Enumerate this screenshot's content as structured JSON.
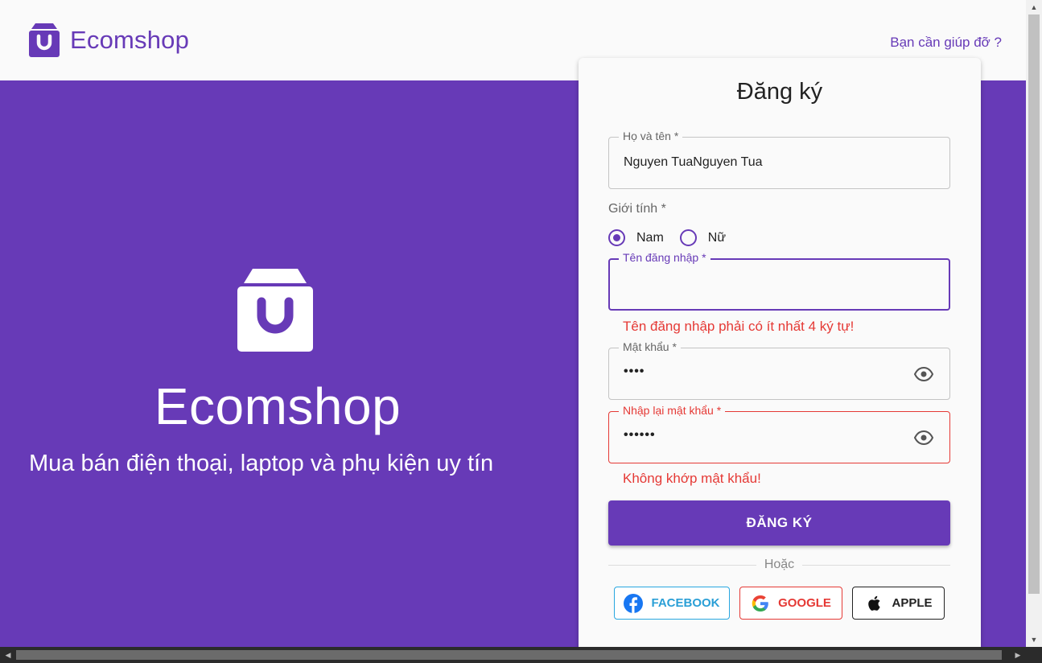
{
  "header": {
    "brand": "Ecomshop",
    "help_link": "Bạn cần giúp đỡ ?"
  },
  "hero": {
    "title": "Ecomshop",
    "subtitle": "Mua bán điện thoại, laptop và phụ kiện uy tín"
  },
  "form": {
    "title": "Đăng ký",
    "fullname": {
      "label": "Họ và tên *",
      "value": "Nguyen TuaNguyen Tua"
    },
    "gender": {
      "label": "Giới tính *",
      "options": [
        {
          "label": "Nam",
          "checked": true
        },
        {
          "label": "Nữ",
          "checked": false
        }
      ]
    },
    "username": {
      "label": "Tên đăng nhập *",
      "value": "",
      "error": "Tên đăng nhập phải có ít nhất 4 ký tự!"
    },
    "password": {
      "label": "Mật khẩu *",
      "value": "••••"
    },
    "confirm_password": {
      "label": "Nhập lại mật khẩu *",
      "value": "••••••",
      "error": "Không khớp mật khẩu!"
    },
    "submit_label": "ĐĂNG KÝ",
    "divider_text": "Hoặc",
    "social": {
      "facebook": "FACEBOOK",
      "google": "GOOGLE",
      "apple": "APPLE"
    }
  },
  "icons": {
    "brand": "shopping-bag-icon",
    "eye": "eye-icon",
    "facebook": "facebook-icon",
    "google": "google-icon",
    "apple": "apple-icon"
  },
  "colors": {
    "primary": "#673ab7",
    "error": "#e53935",
    "facebook": "#2a9fd6"
  }
}
